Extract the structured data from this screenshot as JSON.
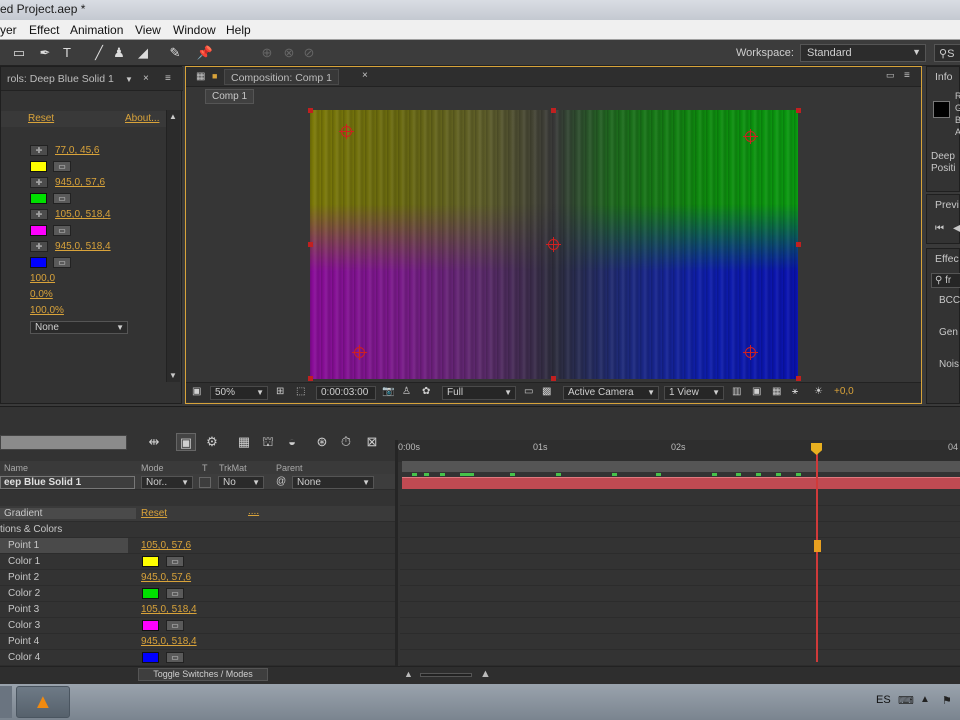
{
  "window": {
    "title": "ed Project.aep *"
  },
  "menu": [
    "yer",
    "Effect",
    "Animation",
    "View",
    "Window",
    "Help"
  ],
  "toolbar": {
    "workspace_label": "Workspace:",
    "workspace_value": "Standard",
    "search_prefix": "S"
  },
  "effect_controls": {
    "tab_title": "rols: Deep Blue Solid 1",
    "reset": "Reset",
    "about": "About...",
    "rows": [
      {
        "value": "77,0, 45,6"
      },
      {
        "color": "#ffff00"
      },
      {
        "value": "945,0, 57,6"
      },
      {
        "color": "#00e000"
      },
      {
        "value": "105,0, 518,4"
      },
      {
        "color": "#ff00ff"
      },
      {
        "value": "945,0, 518,4"
      },
      {
        "color": "#0000ff"
      },
      {
        "value": "100,0"
      },
      {
        "value": "0,0%"
      },
      {
        "value": "100,0%"
      },
      {
        "dropdown": "None"
      }
    ]
  },
  "composition": {
    "tab_title": "Composition: Comp 1",
    "comp_button": "Comp 1",
    "zoom": "50%",
    "timecode": "0:00:03:00",
    "resolution": "Full",
    "camera": "Active Camera",
    "views": "1 View",
    "exposure": "+0,0"
  },
  "right_panels": {
    "info_tab": "Info",
    "info_lines": [
      "R",
      "G",
      "B",
      "A"
    ],
    "info_layer": "Deep",
    "info_position": "Positi",
    "preview_tab": "Previ",
    "effects_tab": "Effec",
    "effects_search": "fr",
    "effects_items": [
      "BCC",
      "Gen",
      "Nois"
    ]
  },
  "timeline": {
    "columns": {
      "name": "Name",
      "mode": "Mode",
      "t": "T",
      "trkmat": "TrkMat",
      "parent": "Parent"
    },
    "layer": {
      "name": "eep Blue Solid 1",
      "mode": "Nor..",
      "trkmat": "No",
      "parent": "None"
    },
    "effect_name": "Gradient",
    "effect_reset": "Reset",
    "effect_dots": "....",
    "group": "tions & Colors",
    "props": [
      {
        "label": "Point 1",
        "value": "105,0, 57,6"
      },
      {
        "label": "Color 1",
        "color": "#ffff00"
      },
      {
        "label": "Point 2",
        "value": "945,0, 57,6"
      },
      {
        "label": "Color 2",
        "color": "#00e000"
      },
      {
        "label": "Point 3",
        "value": "105,0, 518,4"
      },
      {
        "label": "Color 3",
        "color": "#ff00ff"
      },
      {
        "label": "Point 4",
        "value": "945,0, 518,4"
      },
      {
        "label": "Color 4",
        "color": "#0000ff"
      }
    ],
    "ruler": [
      "0:00s",
      "01s",
      "02s",
      "04"
    ],
    "toggle": "Toggle Switches / Modes"
  },
  "taskbar": {
    "lang": "ES"
  }
}
